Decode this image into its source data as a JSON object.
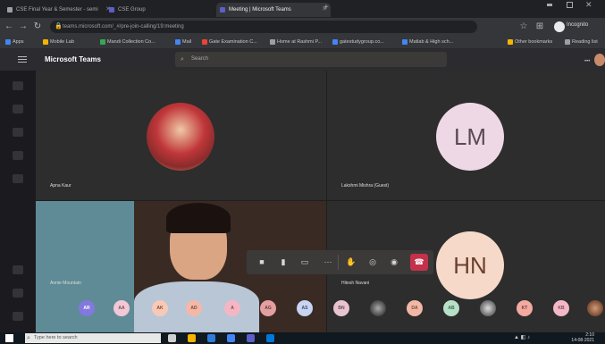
{
  "browser": {
    "tabs": [
      {
        "title": "CSE Final Year & Semester - semi",
        "color": "#9aa0a6"
      },
      {
        "title": "CSE Group",
        "color": "#5b5fc7"
      },
      {
        "title": "Meeting | Microsoft Teams",
        "color": "#5b5fc7",
        "active": true
      }
    ],
    "new_tab_label": "+",
    "url": "teams.microsoft.com/_#/pre-join-calling/19:meeting",
    "profile_label": "Incognito",
    "bookmarks": [
      {
        "label": "Apps",
        "color": "#4285f4"
      },
      {
        "label": "Mobile Lab",
        "color": "#f4b400"
      },
      {
        "label": "Mandi Collection Co...",
        "color": "#34a853"
      },
      {
        "label": "Mail",
        "color": "#4285f4"
      },
      {
        "label": "Gate Examination C...",
        "color": "#ea4335"
      },
      {
        "label": "Home at Rashmi P...",
        "color": "#9aa0a6"
      },
      {
        "label": "gatestudygroup.co...",
        "color": "#4285f4"
      },
      {
        "label": "Matlab & High sch...",
        "color": "#4285f4"
      },
      {
        "label": "Other bookmarks",
        "color": "#f4b400"
      },
      {
        "label": "Reading list",
        "color": "#9aa0a6"
      }
    ]
  },
  "teams": {
    "app_name": "Microsoft Teams",
    "search_placeholder": "Search",
    "avatar_initials": ""
  },
  "tiles": [
    {
      "name": "Apna Kaur",
      "type": "photo"
    },
    {
      "name": "Lakshmi Mishra (Guest)",
      "initials": "LM",
      "color": "#eed8e6",
      "text_color": "#5a4a52"
    },
    {
      "name": "Annie Mountain",
      "type": "video"
    },
    {
      "name": "Hitesh Navani",
      "initials": "HN",
      "color": "#f7d9c9",
      "text_color": "#6a4030"
    }
  ],
  "controls": {
    "buttons": [
      "camera",
      "mic",
      "share",
      "more",
      "raise-hand",
      "chat",
      "participants"
    ],
    "hangup_label": "Leave"
  },
  "participants": [
    {
      "initials": "AR",
      "color": "#8378de"
    },
    {
      "initials": "AA",
      "color": "#f2c8d6"
    },
    {
      "initials": "AK",
      "color": "#f8c9b7"
    },
    {
      "initials": "AD",
      "color": "#f3b8a7"
    },
    {
      "initials": "A",
      "color": "#f5b6c3"
    },
    {
      "initials": "AG",
      "color": "#e4a0a0"
    },
    {
      "initials": "AS",
      "color": "#c8d4f2"
    },
    {
      "initials": "BN",
      "color": "#e7c4cf"
    },
    {
      "initials": "",
      "color": "#555555",
      "type": "photo"
    },
    {
      "initials": "DA",
      "color": "#f2b8a6"
    },
    {
      "initials": "AB",
      "color": "#b8e0c8"
    },
    {
      "initials": "",
      "color": "#888888",
      "type": "photo"
    },
    {
      "initials": "KT",
      "color": "#f3aaa0"
    },
    {
      "initials": "KB",
      "color": "#f3b8c6"
    },
    {
      "initials": "",
      "color": "#b07a60",
      "type": "photo"
    }
  ],
  "taskbar": {
    "search_placeholder": "Type here to search",
    "time": "2:10",
    "date": "14-08-2021"
  }
}
